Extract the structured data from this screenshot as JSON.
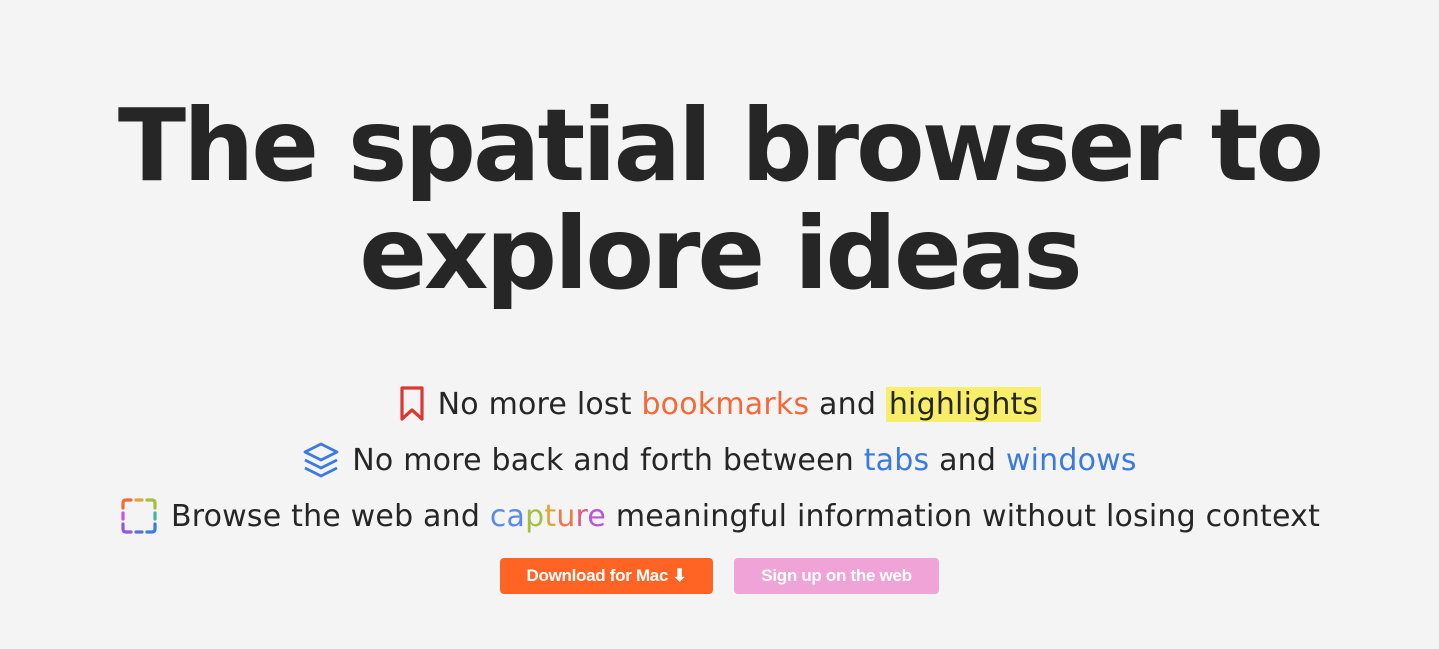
{
  "hero": {
    "title_line1": "The spatial browser to",
    "title_line2": "explore ideas"
  },
  "features": [
    {
      "icon": "bookmark-icon",
      "icon_color": "#d83a32",
      "prefix": "No more lost ",
      "link1": "bookmarks",
      "middle": " and ",
      "link2": "highlights"
    },
    {
      "icon": "layers-icon",
      "icon_color": "#3b7ae0",
      "prefix": "No more back and forth between ",
      "link1": "tabs",
      "middle": " and ",
      "link2": "windows"
    },
    {
      "icon": "dashed-selection-icon",
      "prefix": "Browse the web and ",
      "capture": [
        "ca",
        "p",
        "t",
        "u",
        "r",
        "e"
      ],
      "suffix": " meaningful information without losing context"
    }
  ],
  "cta": {
    "download_label": "Download for Mac ⬇",
    "signup_label": "Sign up on the web"
  },
  "colors": {
    "background": "#f4f4f4",
    "text": "#262626",
    "orange_accent": "#f26a37",
    "blue_accent": "#3b7ae0",
    "highlight_yellow": "#f9ee6a",
    "download_button": "#ff6424",
    "signup_button": "#f0a3d6"
  }
}
